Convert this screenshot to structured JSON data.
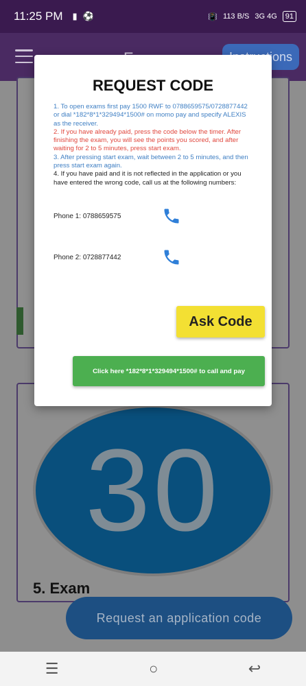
{
  "status_bar": {
    "time": "11:25 PM",
    "left_icons": [
      "sim-icon",
      "soccer-icon"
    ],
    "speed": "113 B/S",
    "network": "3G 4G",
    "battery": "91"
  },
  "app_bar": {
    "title": "E",
    "instructions_label": "Instructions"
  },
  "background": {
    "sign_number": "30",
    "exam_label": "5. Exam",
    "request_button": "Request an application code"
  },
  "dialog": {
    "title": "REQUEST CODE",
    "step1": "1. To open exams first pay 1500 RWF to 0788659575/0728877442 or dial *182*8*1*329494*1500# on momo pay and specify ALEXIS as the receiver.",
    "step2": "2. If you have already paid, press the code below the timer. After finishing the exam, you will see the points you scored, and after waiting for 2 to 5 minutes, press start exam.",
    "step3": "3. After pressing start exam, wait between 2 to 5 minutes, and then press start exam again.",
    "step4": "4. If you have paid and it is not reflected in the application or you have entered the wrong code, call us at the following numbers:",
    "phone1": "Phone 1: 0788659575",
    "phone2": "Phone 2: 0728877442",
    "ask_code": "Ask Code",
    "call_pay": "Click here *182*8*1*329494*1500# to call and pay"
  },
  "nav": {
    "recent": "☰",
    "home": "○",
    "back": "↩"
  },
  "colors": {
    "accent_purple": "#3a1a4f",
    "link_blue": "#3f7fc3",
    "warning_red": "#e0473d",
    "ask_yellow": "#f3e033",
    "pay_green": "#4caf50"
  }
}
